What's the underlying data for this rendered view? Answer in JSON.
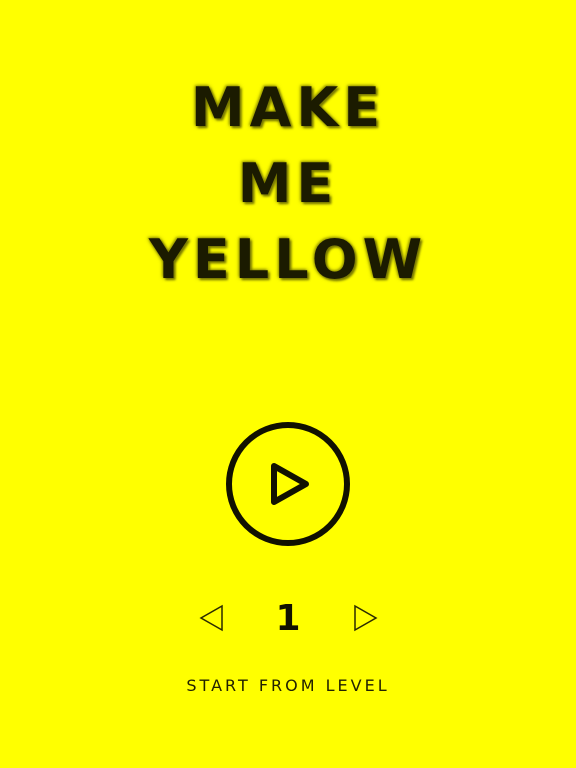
{
  "title": {
    "line1": "MAKE",
    "line2": "ME",
    "line3": "YELLOW"
  },
  "colors": {
    "background": "#ffff00",
    "ink": "#111100"
  },
  "play": {
    "icon": "play-icon"
  },
  "level_selector": {
    "prev_icon": "arrow-left-icon",
    "next_icon": "arrow-right-icon",
    "value": "1",
    "caption": "START FROM LEVEL"
  }
}
